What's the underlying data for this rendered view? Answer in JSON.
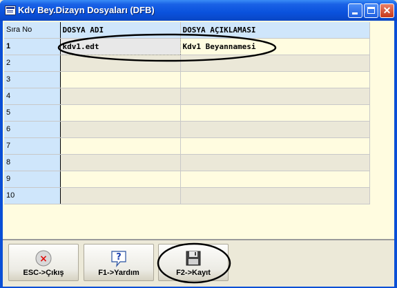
{
  "window": {
    "title": "Kdv Bey.Dizayn Dosyaları (DFB)",
    "controls": {
      "minimize": "",
      "maximize": "",
      "close": "✕"
    }
  },
  "grid": {
    "headers": [
      "Sıra No",
      "DOSYA ADI",
      "DOSYA AÇIKLAMASI"
    ],
    "rows": [
      {
        "no": "1",
        "file": "kdv1.edt",
        "desc": "Kdv1 Beyannamesi"
      },
      {
        "no": "2",
        "file": "",
        "desc": ""
      },
      {
        "no": "3",
        "file": "",
        "desc": ""
      },
      {
        "no": "4",
        "file": "",
        "desc": ""
      },
      {
        "no": "5",
        "file": "",
        "desc": ""
      },
      {
        "no": "6",
        "file": "",
        "desc": ""
      },
      {
        "no": "7",
        "file": "",
        "desc": ""
      },
      {
        "no": "8",
        "file": "",
        "desc": ""
      },
      {
        "no": "9",
        "file": "",
        "desc": ""
      },
      {
        "no": "10",
        "file": "",
        "desc": ""
      }
    ]
  },
  "footer": {
    "esc_label": "ESC->Çıkış",
    "help_label": "F1->Yardım",
    "save_label": "F2->Kayıt"
  },
  "colors": {
    "titlebar": "#0a52dd",
    "grid_background": "#fffce0",
    "header_background": "#cfe6fb",
    "annotation_ellipse": "#000000"
  }
}
